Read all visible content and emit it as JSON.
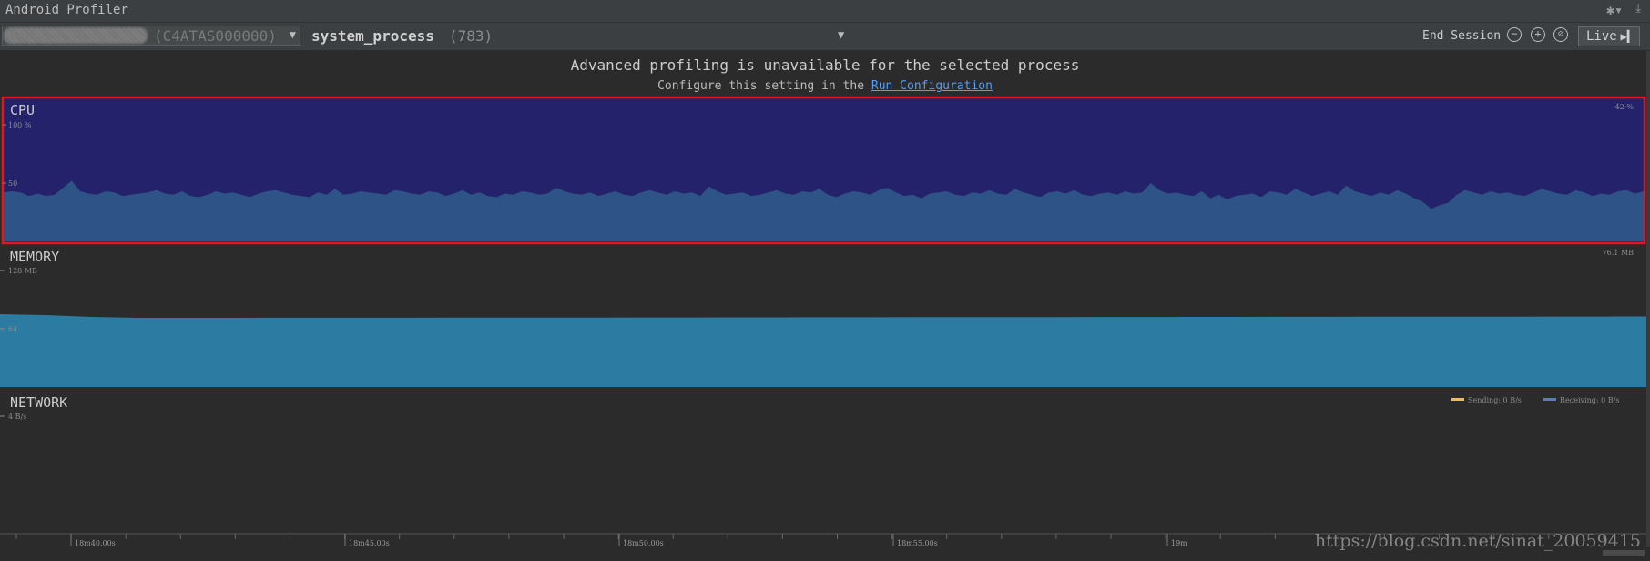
{
  "window": {
    "title": "Android Profiler",
    "settings_icon": "gear-icon",
    "download_icon": "download-icon"
  },
  "toolbar": {
    "device_serial": "(C4ATAS000000)",
    "process_name": "system_process",
    "process_pid": "(783)",
    "end_session_label": "End Session",
    "live_label": "Live"
  },
  "banner": {
    "message": "Advanced profiling is unavailable for the selected process",
    "sub_prefix": "Configure this setting in the",
    "link_text": "Run Configuration"
  },
  "cpu": {
    "label": "CPU",
    "max_label": "100 %",
    "mid_label": "50",
    "current": "42 %",
    "colors": {
      "bg": "#23226a",
      "fill": "#2d5387",
      "border": "#e8141c"
    },
    "values": [
      42,
      43,
      42,
      39,
      41,
      39,
      40,
      46,
      52,
      43,
      41,
      40,
      43,
      42,
      39,
      40,
      41,
      42,
      44,
      41,
      40,
      43,
      39,
      38,
      40,
      43,
      41,
      42,
      40,
      38,
      41,
      43,
      44,
      42,
      40,
      39,
      38,
      42,
      40,
      45,
      40,
      41,
      43,
      42,
      41,
      40,
      44,
      43,
      41,
      40,
      43,
      42,
      39,
      41,
      44,
      40,
      42,
      39,
      38,
      41,
      40,
      43,
      42,
      40,
      41,
      46,
      43,
      41,
      40,
      42,
      39,
      41,
      43,
      40,
      39,
      42,
      44,
      42,
      40,
      43,
      41,
      42,
      39,
      47,
      43,
      40,
      41,
      42,
      39,
      40,
      42,
      44,
      41,
      40,
      43,
      42,
      45,
      40,
      38,
      41,
      43,
      42,
      40,
      44,
      46,
      42,
      39,
      40,
      37,
      41,
      42,
      43,
      40,
      39,
      42,
      41,
      44,
      41,
      40,
      45,
      42,
      40,
      38,
      42,
      43,
      41,
      44,
      40,
      39,
      41,
      42,
      40,
      43,
      41,
      42,
      50,
      44,
      41,
      42,
      40,
      39,
      43,
      37,
      40,
      36,
      39,
      40,
      41,
      38,
      43,
      42,
      40,
      45,
      42,
      39,
      41,
      43,
      40,
      48,
      43,
      41,
      39,
      42,
      40,
      44,
      41,
      37,
      34,
      28,
      31,
      33,
      40,
      44,
      42,
      40,
      43,
      41,
      42,
      40,
      39,
      42,
      45,
      43,
      41,
      40,
      44,
      42,
      39,
      41,
      40,
      43,
      44,
      41,
      43
    ]
  },
  "memory": {
    "label": "MEMORY",
    "max_label": "128 MB",
    "mid_label": "64",
    "current": "76.1 MB",
    "colors": {
      "fill": "#2b7ba3"
    },
    "values": [
      80,
      79,
      77,
      76,
      76,
      76,
      76.1,
      76.1,
      76.1,
      76.1,
      76.2,
      76.2,
      76.3,
      76.3,
      76.4,
      76.4,
      76.5,
      76.5,
      76.6,
      76.6,
      76.7,
      76.7,
      76.8,
      76.8,
      76.9,
      76.9,
      77,
      77,
      77.1,
      77.1,
      77.2,
      77.2,
      77.3,
      77.3,
      77.4,
      77.4,
      77.5
    ]
  },
  "network": {
    "label": "NETWORK",
    "max_label": "4 B/s",
    "sending_label": "Sending: 0 B/s",
    "receiving_label": "Receiving: 0 B/s",
    "colors": {
      "sending": "#f5b85a",
      "receiving": "#5b7ad6"
    }
  },
  "timeline": {
    "ticks": [
      "18m40.00s",
      "18m45.00s",
      "18m50.00s",
      "18m55.00s",
      "19m"
    ]
  },
  "watermark": "https://blog.csdn.net/sinat_20059415"
}
